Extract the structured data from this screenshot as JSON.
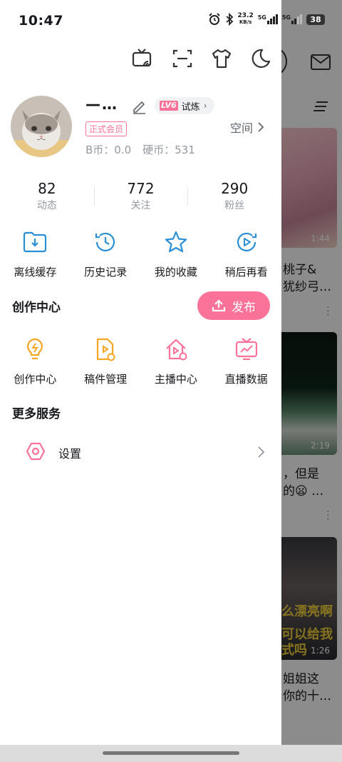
{
  "status_bar": {
    "time": "10:47",
    "net_speed": "23.2",
    "net_unit": "KB/s",
    "signal1": "5G",
    "signal2": "5G",
    "battery": "38"
  },
  "profile": {
    "username": "—…",
    "level": "LV6",
    "level_badge_label": "试炼",
    "vip_label": "正式会员",
    "space_label": "空间",
    "bcoin": "B币：0.0",
    "coin": "硬币：531"
  },
  "stats": [
    {
      "value": "82",
      "label": "动态"
    },
    {
      "value": "772",
      "label": "关注"
    },
    {
      "value": "290",
      "label": "粉丝"
    }
  ],
  "quick_actions": [
    {
      "label": "离线缓存",
      "icon": "download-folder-icon"
    },
    {
      "label": "历史记录",
      "icon": "history-clock-icon"
    },
    {
      "label": "我的收藏",
      "icon": "star-icon"
    },
    {
      "label": "稍后再看",
      "icon": "watch-later-icon"
    }
  ],
  "creation": {
    "title": "创作中心",
    "publish_label": "发布",
    "items": [
      {
        "label": "创作中心",
        "icon": "lightbulb-icon"
      },
      {
        "label": "稿件管理",
        "icon": "manuscript-icon"
      },
      {
        "label": "主播中心",
        "icon": "streamer-home-icon"
      },
      {
        "label": "直播数据",
        "icon": "live-data-icon"
      }
    ]
  },
  "more_services": {
    "title": "更多服务",
    "settings_label": "设置"
  },
  "background_feed": {
    "durations": [
      "1:44",
      "2:19",
      "1:26"
    ],
    "titles": [
      "桃子&",
      "犹纱弓…",
      "，但是",
      "的😦 …",
      "姐姐这",
      "你的十…"
    ],
    "overlay_text": [
      "么漂亮啊",
      "可以给我",
      "式吗"
    ]
  },
  "colors": {
    "accent": "#fb7299",
    "creation_icon": "#f5a623",
    "blue_icon": "#2b8fd6"
  }
}
